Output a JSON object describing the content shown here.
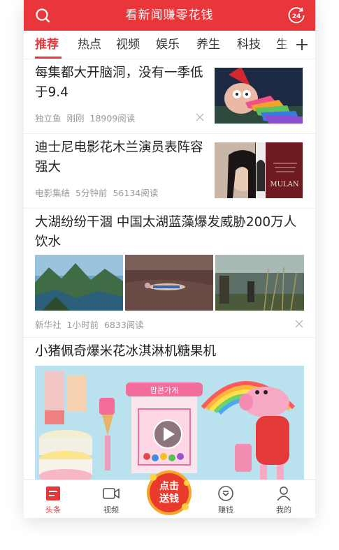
{
  "header": {
    "title": "看新闻赚零花钱",
    "timer_badge": "24"
  },
  "tabs": [
    {
      "label": "推荐",
      "active": true
    },
    {
      "label": "热点"
    },
    {
      "label": "视频"
    },
    {
      "label": "娱乐"
    },
    {
      "label": "养生"
    },
    {
      "label": "科技"
    },
    {
      "label": "生"
    }
  ],
  "feed": [
    {
      "title": "每集都大开脑洞，没有一季低于9.4",
      "source": "独立鱼",
      "time": "刚刚",
      "reads": "18909阅读"
    },
    {
      "title": "迪士尼电影花木兰演员表阵容强大",
      "source": "电影集结",
      "time": "5分钟前",
      "reads": "56134阅读",
      "thumb_text": "MULAN"
    },
    {
      "title": "大湖纷纷干涸 中国太湖蓝藻爆发威胁200万人饮水",
      "source": "新华社",
      "time": "1小时前",
      "reads": "6833阅读"
    },
    {
      "title": "小猪佩奇爆米花冰淇淋机糖果机",
      "video_sign": "팝콘가게"
    }
  ],
  "promo": {
    "line1": "点击",
    "line2": "送钱"
  },
  "bottom_nav": [
    {
      "label": "头条",
      "icon": "news-icon",
      "active": true
    },
    {
      "label": "视频",
      "icon": "video-icon"
    },
    {
      "label": "赚钱",
      "icon": "coin-icon"
    },
    {
      "label": "我的",
      "icon": "user-icon"
    }
  ],
  "colors": {
    "brand": "#e8363b",
    "text": "#222222",
    "meta": "#999999"
  }
}
